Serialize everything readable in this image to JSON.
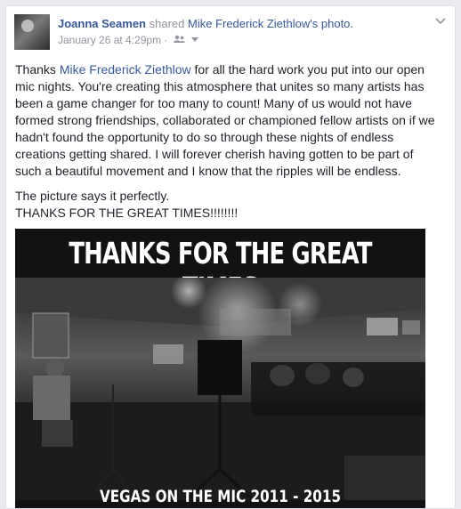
{
  "post": {
    "author": "Joanna Seamen",
    "action": "shared",
    "shared_owner": "Mike Frederick Ziethlow's",
    "shared_object": "photo.",
    "timestamp": "January 26 at 4:29pm",
    "separator": "·",
    "privacy_icon": "friends-icon",
    "menu_icon": "chevron-down-icon"
  },
  "message": {
    "p1_before": "Thanks ",
    "p1_mention": "Mike Frederick Ziethlow",
    "p1_after": " for all the hard work you put into our open mic nights. You're creating this atmosphere that unites so many artists has been a game changer for too many to count! Many of us would not have formed strong friendships, collaborated or championed fellow artists on if we hadn't found the opportunity to do so through these nights of endless creations getting shared. I will forever cherish having gotten to be part of such a beautiful movement and I know that the ripples will be endless.",
    "p2_line1": "The picture says it perfectly.",
    "p2_line2": "THANKS FOR THE GREAT TIMES!!!!!!!!"
  },
  "photo": {
    "title": "THANKS FOR THE GREAT TIMES",
    "caption": "VEGAS ON THE MIC  2011 - 2015"
  }
}
